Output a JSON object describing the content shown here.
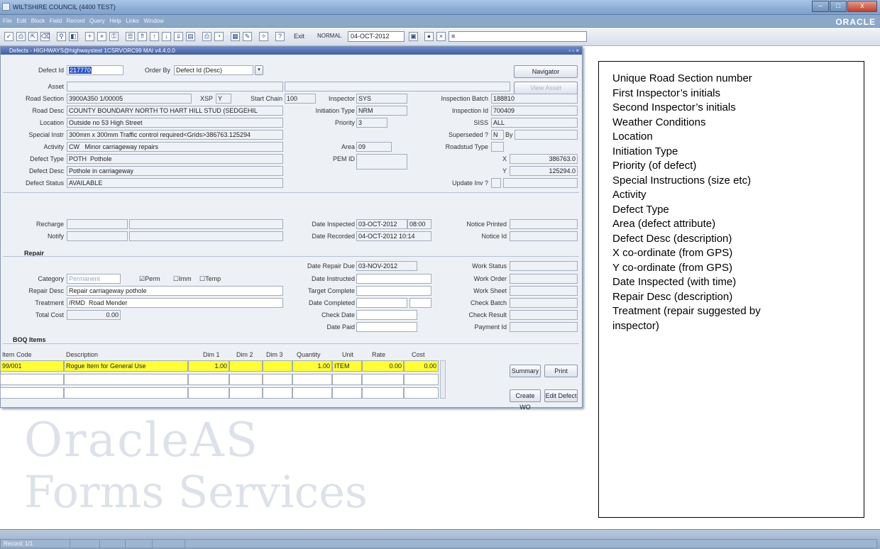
{
  "window": {
    "title": "WILTSHIRE COUNCIL (4400 TEST)",
    "min": "–",
    "max": "□",
    "close": "x"
  },
  "menu": [
    "File",
    "Edit",
    "Block",
    "Field",
    "Record",
    "Query",
    "Help",
    "Links",
    "Window"
  ],
  "brand": "ORACLE",
  "toolbar": {
    "icons": [
      "save-icon",
      "print-icon",
      "exit-icon",
      "clear-icon",
      "search-icon",
      "query-icon",
      "insert-icon",
      "delete-icon",
      "lock-icon",
      "list-icon",
      "up-icon",
      "prev-icon",
      "next-icon",
      "down-icon",
      "block-icon",
      "printer-icon",
      "attach-icon",
      "calendar-icon",
      "edit-icon",
      "wand-icon",
      "help-icon"
    ],
    "exit_label": "Exit",
    "mode": "NORMAL",
    "date": "04-OCT-2012",
    "code": "≡"
  },
  "form": {
    "title": "Defects - HIGHWAYS@highwaystest 1CSRVORC99 MAI v4.4.0.0",
    "defect_id": {
      "label": "Defect Id",
      "value": "217770"
    },
    "order_by": {
      "label": "Order By",
      "value": "Defect Id (Desc)"
    },
    "navigator": "Navigator",
    "view_asset": "View Asset",
    "asset": {
      "label": "Asset",
      "value": ""
    },
    "road_section": {
      "label": "Road Section",
      "value": "3900A350 1/00005"
    },
    "xsp": {
      "label": "XSP",
      "value": "Y"
    },
    "start_chain": {
      "label": "Start Chain",
      "value": "100"
    },
    "inspector": {
      "label": "Inspector",
      "value": "SYS"
    },
    "inspection_batch": {
      "label": "Inspection Batch",
      "value": "188810"
    },
    "road_desc": {
      "label": "Road Desc",
      "value": "COUNTY BOUNDARY NORTH TO HART HILL STUD (SEDGEHIL"
    },
    "initiation_type": {
      "label": "Initiation Type",
      "value": "NRM"
    },
    "inspection_id": {
      "label": "Inspection Id",
      "value": "700409"
    },
    "location": {
      "label": "Location",
      "value": "Outside no 53 High Street"
    },
    "priority": {
      "label": "Priority",
      "value": "3"
    },
    "siss": {
      "label": "SISS",
      "value": "ALL"
    },
    "special_instr": {
      "label": "Special Instr",
      "value": "300mm x 300mm Traffic control required<Grids>386763.125294"
    },
    "superseded": {
      "label": "Superseded ?",
      "value": "N",
      "by_label": "By",
      "by_value": ""
    },
    "activity": {
      "label": "Activity",
      "code": "CW",
      "value": "Minor carriageway repairs"
    },
    "area": {
      "label": "Area",
      "value": "09"
    },
    "roadstud_type": {
      "label": "Roadstud Type",
      "value": ""
    },
    "defect_type": {
      "label": "Defect Type",
      "code": "POTH",
      "value": "Pothole"
    },
    "pem_id": {
      "label": "PEM ID",
      "value": ""
    },
    "x": {
      "label": "X",
      "value": "386763.0"
    },
    "defect_desc": {
      "label": "Defect Desc",
      "value": "Pothole in carriageway"
    },
    "y": {
      "label": "Y",
      "value": "125294.0"
    },
    "defect_status": {
      "label": "Defect Status",
      "value": "AVAILABLE"
    },
    "update_inv": {
      "label": "Update Inv ?",
      "value": ""
    },
    "recharge": {
      "label": "Recharge",
      "value": ""
    },
    "notify": {
      "label": "Notify",
      "value": ""
    },
    "date_inspected": {
      "label": "Date Inspected",
      "value": "03-OCT-2012",
      "time": "08:00"
    },
    "date_recorded": {
      "label": "Date Recorded",
      "value": "04-OCT-2012 10:14"
    },
    "notice_printed": {
      "label": "Notice Printed",
      "value": ""
    },
    "notice_id": {
      "label": "Notice Id",
      "value": ""
    }
  },
  "repair": {
    "heading": "Repair",
    "category": {
      "label": "Category",
      "value": "Permanent"
    },
    "perm": {
      "label": "Perm",
      "checked": "☑"
    },
    "imm": {
      "label": "Imm",
      "checked": "☐"
    },
    "temp": {
      "label": "Temp",
      "checked": "☐"
    },
    "repair_desc": {
      "label": "Repair Desc",
      "value": "Repair carriageway pothole"
    },
    "treatment": {
      "label": "Treatment",
      "code": "/RMD",
      "value": "Road Mender"
    },
    "total_cost": {
      "label": "Total Cost",
      "value": "0.00"
    },
    "date_repair_due": {
      "label": "Date Repair Due",
      "value": "03-NOV-2012"
    },
    "date_instructed": {
      "label": "Date Instructed",
      "value": ""
    },
    "target_complete": {
      "label": "Target Complete",
      "value": ""
    },
    "date_completed": {
      "label": "Date Completed",
      "value": ""
    },
    "check_date": {
      "label": "Check Date",
      "value": ""
    },
    "date_paid": {
      "label": "Date Paid",
      "value": ""
    },
    "work_status": {
      "label": "Work Status",
      "value": ""
    },
    "work_order": {
      "label": "Work Order",
      "value": ""
    },
    "work_sheet": {
      "label": "Work Sheet",
      "value": ""
    },
    "check_batch": {
      "label": "Check Batch",
      "value": ""
    },
    "check_result": {
      "label": "Check Result",
      "value": ""
    },
    "payment_id": {
      "label": "Payment Id",
      "value": ""
    }
  },
  "boq": {
    "heading": "BOQ Items",
    "headers": [
      "Item Code",
      "Description",
      "Dim 1",
      "Dim 2",
      "Dim 3",
      "Quantity",
      "Unit",
      "Rate",
      "Cost"
    ],
    "rows": [
      [
        "99/001",
        "Rogue Item for General Use",
        "1.00",
        "",
        "",
        "1.00",
        "ITEM",
        "0.00",
        "0.00"
      ],
      [
        "",
        "",
        "",
        "",
        "",
        "",
        "",
        "",
        ""
      ],
      [
        "",
        "",
        "",
        "",
        "",
        "",
        "",
        "",
        ""
      ]
    ],
    "summary": "Summary",
    "print": "Print",
    "create_wo": "Create WO",
    "edit_defect": "Edit Defect"
  },
  "watermark": {
    "line1": "OracleAS",
    "line2": "Forms Services"
  },
  "notes": [
    "Unique Road Section number",
    "First Inspector’s initials",
    "Second Inspector’s initials",
    "Weather Conditions",
    "Location",
    "Initiation Type",
    "Priority (of defect)",
    "Special Instructions (size etc)",
    "Activity",
    "Defect Type",
    "Area (defect attribute)",
    "Defect Desc (description)",
    "X co-ordinate (from GPS)",
    "Y co-ordinate (from GPS)",
    "Date Inspected (with time)",
    "Repair Desc (description)",
    "Treatment (repair suggested by",
    "inspector)"
  ],
  "status": {
    "record": "Record: 1/1"
  },
  "colors": {
    "highlight_row": "#ffff33",
    "selection": "#2b56c8",
    "form_header": "#3f5fa6"
  }
}
